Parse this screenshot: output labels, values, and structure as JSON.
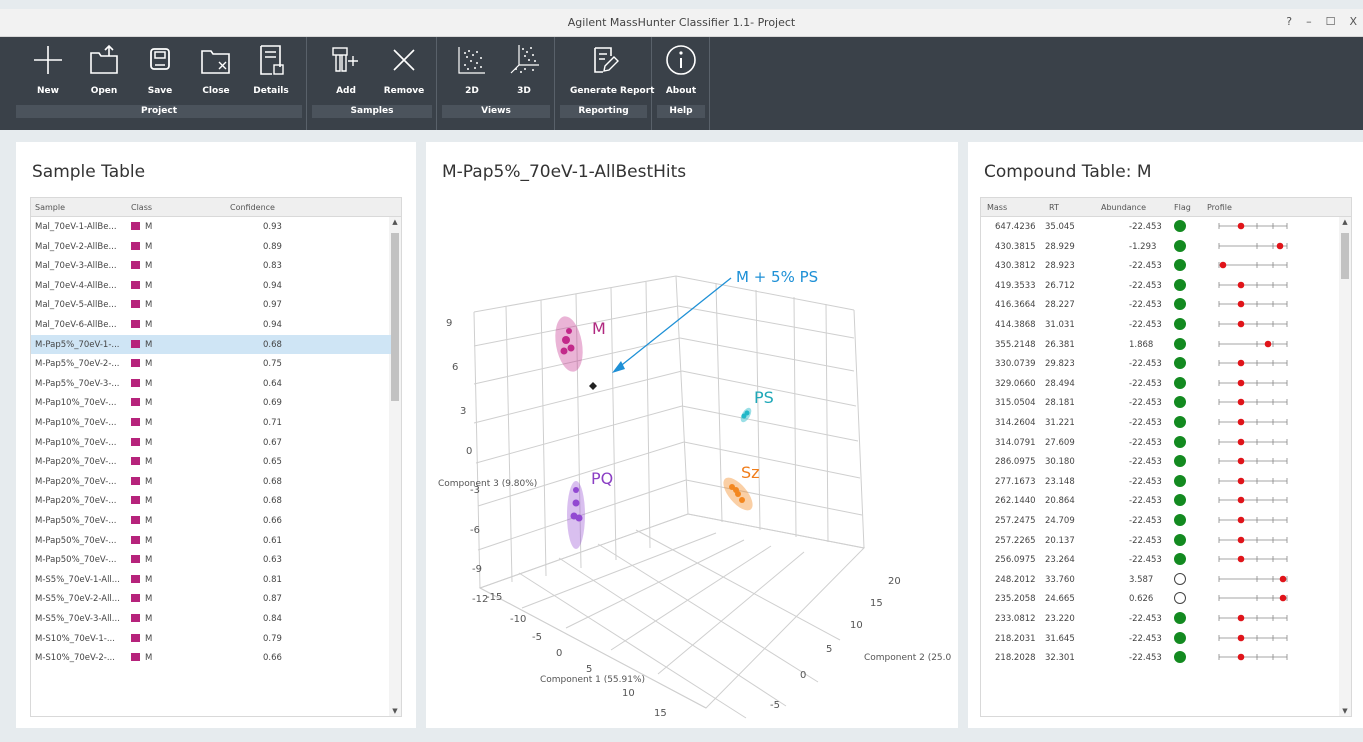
{
  "window": {
    "title": "Agilent MassHunter Classifier 1.1- Project",
    "controls": [
      "?",
      "–",
      "☐",
      "X"
    ]
  },
  "ribbon": {
    "groups": [
      {
        "label": "Project",
        "buttons": [
          "New",
          "Open",
          "Save",
          "Close",
          "Details"
        ]
      },
      {
        "label": "Samples",
        "buttons": [
          "Add",
          "Remove"
        ]
      },
      {
        "label": "Views",
        "buttons": [
          "2D",
          "3D"
        ]
      },
      {
        "label": "Reporting",
        "buttons": [
          "Generate Report"
        ]
      },
      {
        "label": "Help",
        "buttons": [
          "About"
        ]
      }
    ]
  },
  "sample_table": {
    "title": "Sample Table",
    "columns": [
      "Sample",
      "Class",
      "Confidence"
    ],
    "selected_index": 6,
    "class_color": "#b6237b",
    "rows": [
      [
        "Mal_70eV-1-AllBe...",
        "M",
        "0.93"
      ],
      [
        "Mal_70eV-2-AllBe...",
        "M",
        "0.89"
      ],
      [
        "Mal_70eV-3-AllBe...",
        "M",
        "0.83"
      ],
      [
        "Mal_70eV-4-AllBe...",
        "M",
        "0.94"
      ],
      [
        "Mal_70eV-5-AllBe...",
        "M",
        "0.97"
      ],
      [
        "Mal_70eV-6-AllBe...",
        "M",
        "0.94"
      ],
      [
        "M-Pap5%_70eV-1-...",
        "M",
        "0.68"
      ],
      [
        "M-Pap5%_70eV-2-...",
        "M",
        "0.75"
      ],
      [
        "M-Pap5%_70eV-3-...",
        "M",
        "0.64"
      ],
      [
        "M-Pap10%_70eV-...",
        "M",
        "0.69"
      ],
      [
        "M-Pap10%_70eV-...",
        "M",
        "0.71"
      ],
      [
        "M-Pap10%_70eV-...",
        "M",
        "0.67"
      ],
      [
        "M-Pap20%_70eV-...",
        "M",
        "0.65"
      ],
      [
        "M-Pap20%_70eV-...",
        "M",
        "0.68"
      ],
      [
        "M-Pap20%_70eV-...",
        "M",
        "0.68"
      ],
      [
        "M-Pap50%_70eV-...",
        "M",
        "0.66"
      ],
      [
        "M-Pap50%_70eV-...",
        "M",
        "0.61"
      ],
      [
        "M-Pap50%_70eV-...",
        "M",
        "0.63"
      ],
      [
        "M-S5%_70eV-1-All...",
        "M",
        "0.81"
      ],
      [
        "M-S5%_70eV-2-All...",
        "M",
        "0.87"
      ],
      [
        "M-S5%_70eV-3-All...",
        "M",
        "0.84"
      ],
      [
        "M-S10%_70eV-1-...",
        "M",
        "0.79"
      ],
      [
        "M-S10%_70eV-2-...",
        "M",
        "0.66"
      ]
    ]
  },
  "plot": {
    "title": "M-Pap5%_70eV-1-AllBestHits",
    "annotation": "M + 5% PS",
    "group_labels": [
      {
        "text": "M",
        "color": "#b0287f"
      },
      {
        "text": "PS",
        "color": "#1fa8b8"
      },
      {
        "text": "PQ",
        "color": "#8b3fc4"
      },
      {
        "text": "Sz",
        "color": "#f07d1a"
      }
    ],
    "axis_labels": {
      "component1": "Component 1 (55.91%)",
      "component2": "Component 2 (25.0",
      "component3": "Component 3 (9.80%)"
    },
    "z_ticks": [
      "9",
      "6",
      "3",
      "0",
      "-3",
      "-6",
      "-9",
      "-12"
    ],
    "x_ticks": [
      "-15",
      "-10",
      "-5",
      "0",
      "5",
      "10",
      "15"
    ],
    "y_ticks": [
      "20",
      "15",
      "10",
      "5",
      "0",
      "-5"
    ]
  },
  "compound_table": {
    "title": "Compound Table: M",
    "columns": [
      "Mass",
      "RT",
      "Abundance",
      "Flag",
      "Profile"
    ],
    "rows": [
      [
        "647.4236",
        "35.045",
        "-22.453",
        "filled",
        0.3
      ],
      [
        "430.3815",
        "28.929",
        "-1.293",
        "filled",
        0.95
      ],
      [
        "430.3812",
        "28.923",
        "-22.453",
        "filled",
        0.0
      ],
      [
        "419.3533",
        "26.712",
        "-22.453",
        "filled",
        0.3
      ],
      [
        "416.3664",
        "28.227",
        "-22.453",
        "filled",
        0.3
      ],
      [
        "414.3868",
        "31.031",
        "-22.453",
        "filled",
        0.3
      ],
      [
        "355.2148",
        "26.381",
        "1.868",
        "filled",
        0.75
      ],
      [
        "330.0739",
        "29.823",
        "-22.453",
        "filled",
        0.3
      ],
      [
        "329.0660",
        "28.494",
        "-22.453",
        "filled",
        0.3
      ],
      [
        "315.0504",
        "28.181",
        "-22.453",
        "filled",
        0.3
      ],
      [
        "314.2604",
        "31.221",
        "-22.453",
        "filled",
        0.3
      ],
      [
        "314.0791",
        "27.609",
        "-22.453",
        "filled",
        0.3
      ],
      [
        "286.0975",
        "30.180",
        "-22.453",
        "filled",
        0.3
      ],
      [
        "277.1673",
        "23.148",
        "-22.453",
        "filled",
        0.3
      ],
      [
        "262.1440",
        "20.864",
        "-22.453",
        "filled",
        0.3
      ],
      [
        "257.2475",
        "24.709",
        "-22.453",
        "filled",
        0.3
      ],
      [
        "257.2265",
        "20.137",
        "-22.453",
        "filled",
        0.3
      ],
      [
        "256.0975",
        "23.264",
        "-22.453",
        "filled",
        0.3
      ],
      [
        "248.2012",
        "33.760",
        "3.587",
        "empty",
        1.0
      ],
      [
        "235.2058",
        "24.665",
        "0.626",
        "empty",
        1.0
      ],
      [
        "233.0812",
        "23.220",
        "-22.453",
        "filled",
        0.3
      ],
      [
        "218.2031",
        "31.645",
        "-22.453",
        "filled",
        0.3
      ],
      [
        "218.2028",
        "32.301",
        "-22.453",
        "filled",
        0.3
      ]
    ]
  }
}
